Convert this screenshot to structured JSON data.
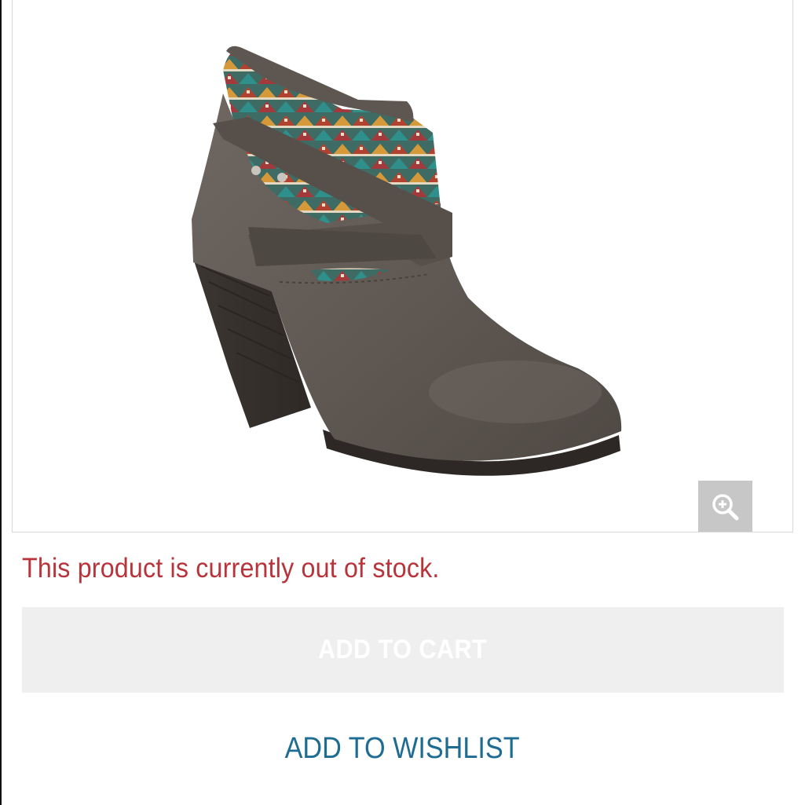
{
  "product": {
    "image_alt": "Gray ankle bootie with tribal print cuff and wrap strap",
    "zoom_icon": "zoom-in-icon"
  },
  "stock": {
    "message": "This product is currently out of stock."
  },
  "actions": {
    "add_to_cart_label": "ADD TO CART",
    "add_to_wishlist_label": "ADD TO WISHLIST"
  },
  "colors": {
    "out_of_stock_red": "#b8333a",
    "disabled_button_bg": "#efefef",
    "wishlist_blue": "#1f6c93",
    "zoom_button_bg": "#c7c7c7"
  }
}
